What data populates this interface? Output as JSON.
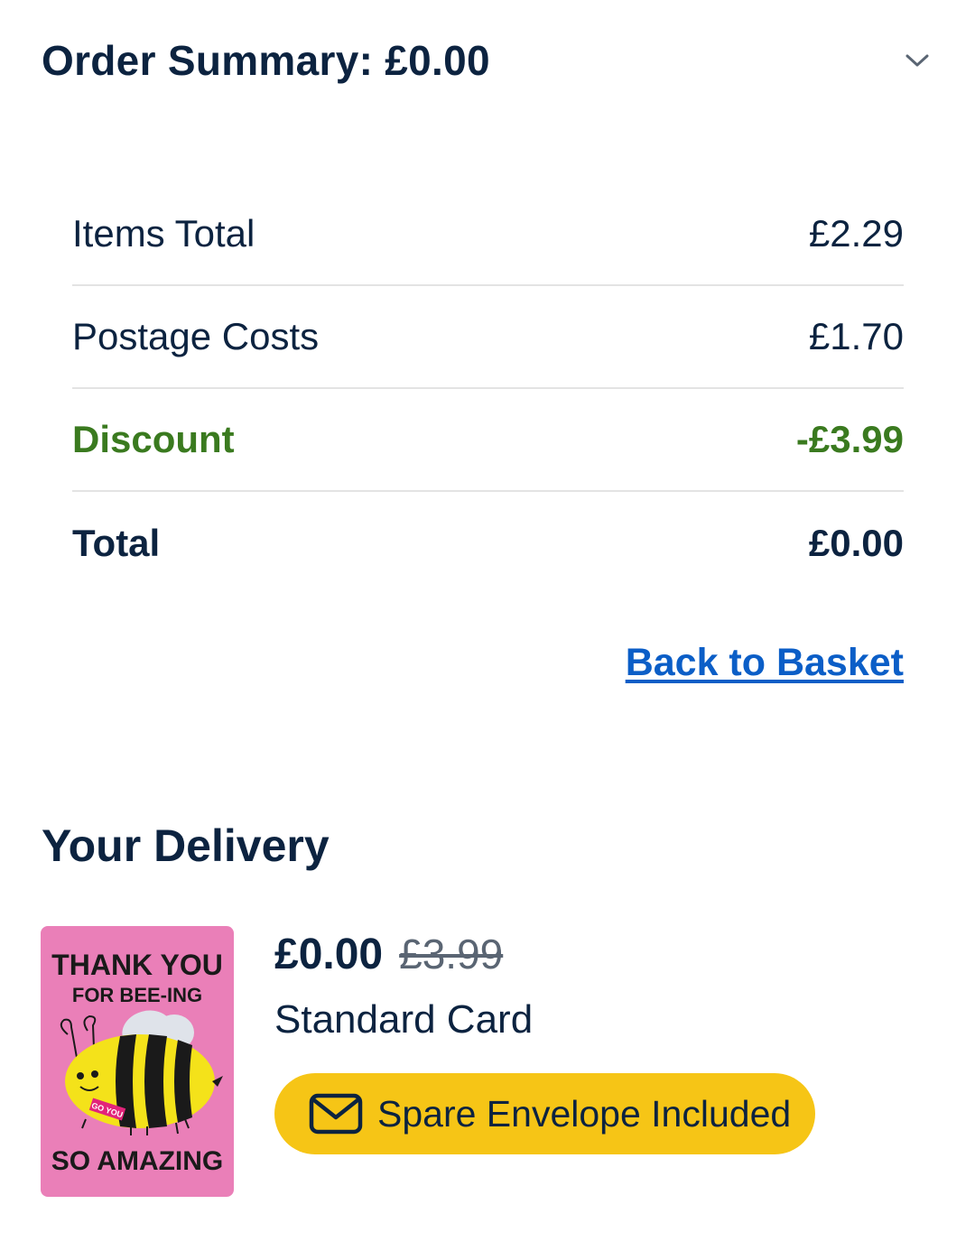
{
  "summary": {
    "title": "Order Summary: £0.00",
    "rows": [
      {
        "label": "Items Total",
        "value": "£2.29"
      },
      {
        "label": "Postage Costs",
        "value": "£1.70"
      },
      {
        "label": "Discount",
        "value": "-£3.99"
      },
      {
        "label": "Total",
        "value": "£0.00"
      }
    ],
    "back_link": "Back to Basket"
  },
  "delivery": {
    "title": "Your Delivery",
    "item": {
      "card_text_line1": "THANK YOU",
      "card_text_line2": "FOR BEE-ING",
      "card_text_line3": "SO AMAZING",
      "card_badge": "GO YOU",
      "price_now": "£0.00",
      "price_was": "£3.99",
      "type": "Standard Card",
      "envelope_label": "Spare Envelope Included"
    }
  },
  "icons": [
    "chevron-down-icon",
    "envelope-icon"
  ],
  "colors": {
    "navy": "#0c2340",
    "discount_green": "#3a7a1f",
    "link_blue": "#0b5ec7",
    "pill_yellow": "#f6c516",
    "card_pink": "#ea7fb8"
  }
}
